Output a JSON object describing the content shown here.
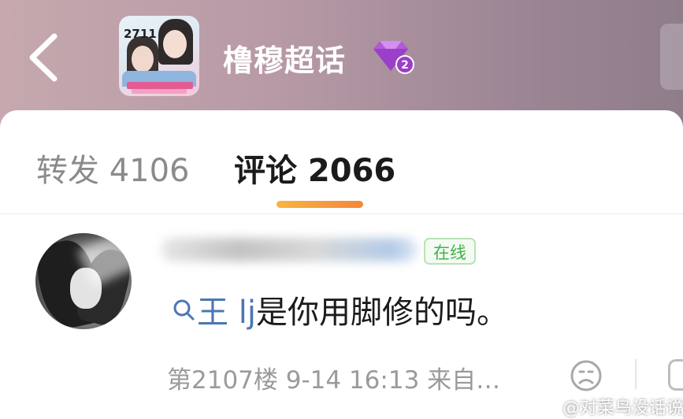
{
  "header": {
    "back_icon": "chevron-left-icon",
    "title": "橹穆超话",
    "level_badge": "2",
    "cover_number": "2711"
  },
  "tabs": [
    {
      "label": "转发 4106",
      "active": false
    },
    {
      "label": "评论 2066",
      "active": true
    }
  ],
  "comment": {
    "status_badge": "在线",
    "mention": "王 lj",
    "text": "是你用脚修的吗。",
    "meta": "第2107楼  9-14 16:13  来自…",
    "reaction_icon": "sad-face-icon"
  },
  "watermark": "@对菜鸟没话说",
  "colors": {
    "accent_orange": "#f5863b",
    "online_green": "#3fb34a",
    "mention_blue": "#4a78b2",
    "gem_purple": "#b35ad6"
  }
}
